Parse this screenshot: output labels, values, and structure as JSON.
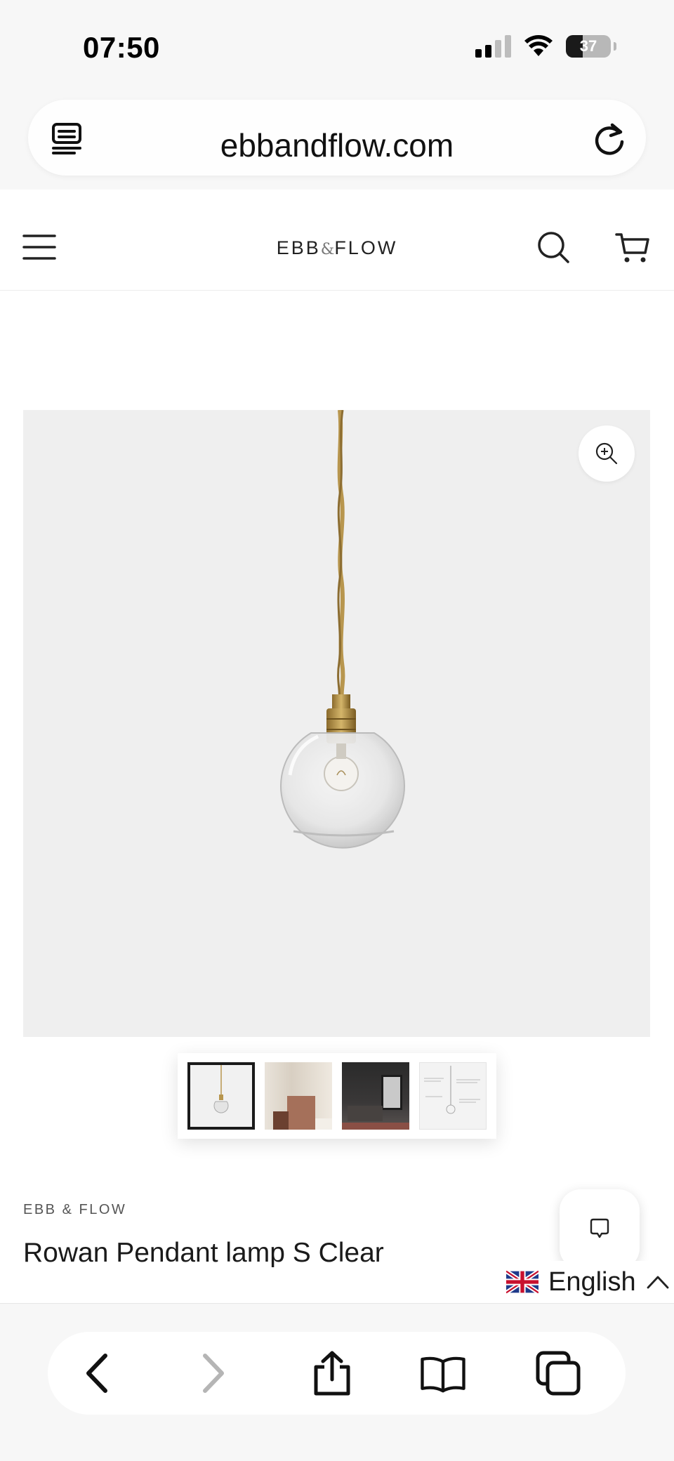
{
  "status_bar": {
    "time": "07:50",
    "battery_percent": "37",
    "battery_level": 0.37,
    "signal_bars": 4,
    "signal_bars_active": 2,
    "icons": [
      "cellular-signal-icon",
      "wifi-icon",
      "battery-icon"
    ]
  },
  "browser": {
    "url": "ebbandflow.com",
    "left_icon": "tab-overview-icon",
    "right_icon": "reload-icon",
    "toolbar": [
      "back-icon",
      "forward-icon",
      "share-icon",
      "bookmarks-icon",
      "tabs-icon"
    ]
  },
  "site_header": {
    "logo_left": "EBB",
    "logo_amp": "&",
    "logo_right": "FLOW",
    "icons": [
      "menu-icon",
      "search-icon",
      "cart-icon"
    ]
  },
  "product": {
    "vendor": "EBB & FLOW",
    "title": "Rowan Pendant lamp S Clear",
    "image_icons": [
      "zoom-in-icon"
    ],
    "thumbnail_count": 4,
    "active_thumbnail": 1
  },
  "widgets": {
    "chat_icon": "chat-bubble-icon",
    "language": "English",
    "language_flag": "uk-flag-icon",
    "language_toggle_icon": "chevron-up-icon"
  },
  "colors": {
    "browser_chrome": "#f7f7f7",
    "image_background": "#efefef",
    "cord_brass": "#b8964e",
    "text_primary": "#1a1a1a"
  }
}
